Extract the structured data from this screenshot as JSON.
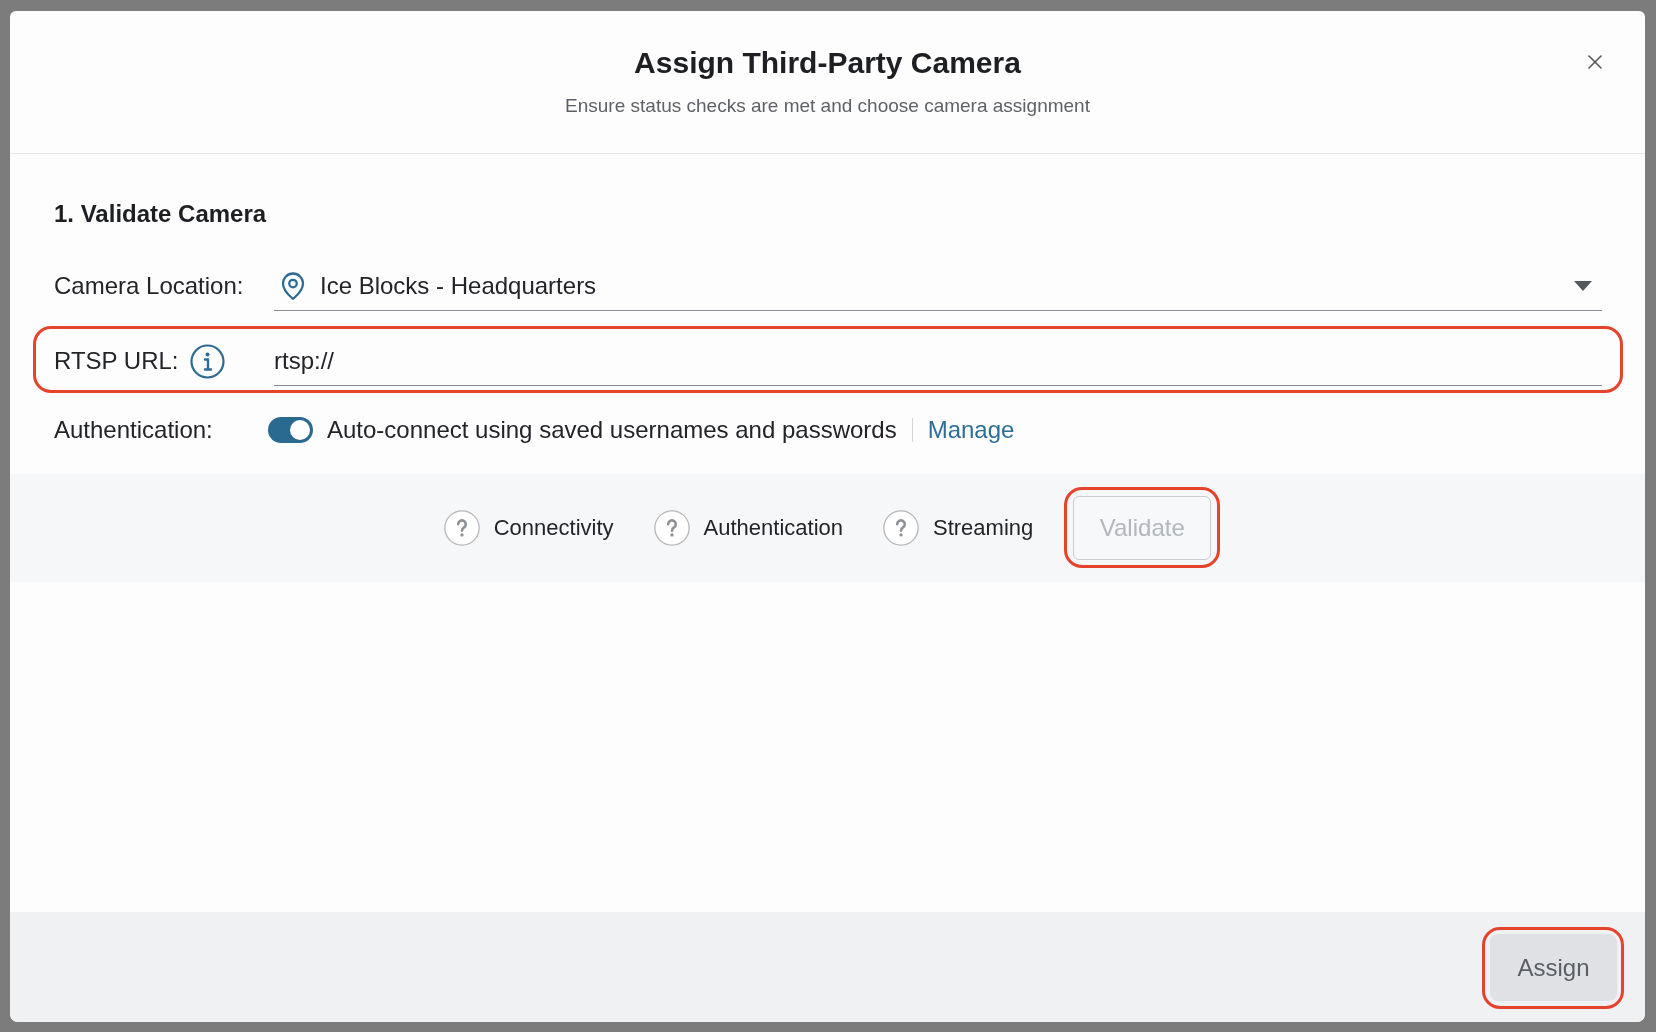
{
  "dialog": {
    "title": "Assign Third-Party Camera",
    "subtitle": "Ensure status checks are met and choose camera assignment"
  },
  "section": {
    "heading": "1. Validate Camera"
  },
  "fields": [
    {
      "kind": "select",
      "label": "Camera Location:",
      "value": "Ice Blocks - Headquarters",
      "info": false,
      "highlighted": false
    },
    {
      "kind": "text",
      "label": "RTSP URL:",
      "value": "rtsp://",
      "info": true,
      "highlighted": true
    }
  ],
  "authentication": {
    "label": "Authentication:",
    "on": true,
    "text": "Auto-connect using saved usernames and passwords",
    "link": "Manage"
  },
  "status_checks": [
    {
      "label": "Connectivity",
      "kind": "pending"
    },
    {
      "label": "Authentication",
      "kind": "pending"
    },
    {
      "label": "Streaming",
      "kind": "pending"
    }
  ],
  "validate_button": {
    "label": "Validate",
    "disabled": true,
    "highlighted": true
  },
  "footer": {
    "assign_button": {
      "label": "Assign",
      "disabled": true,
      "highlighted": true
    }
  }
}
